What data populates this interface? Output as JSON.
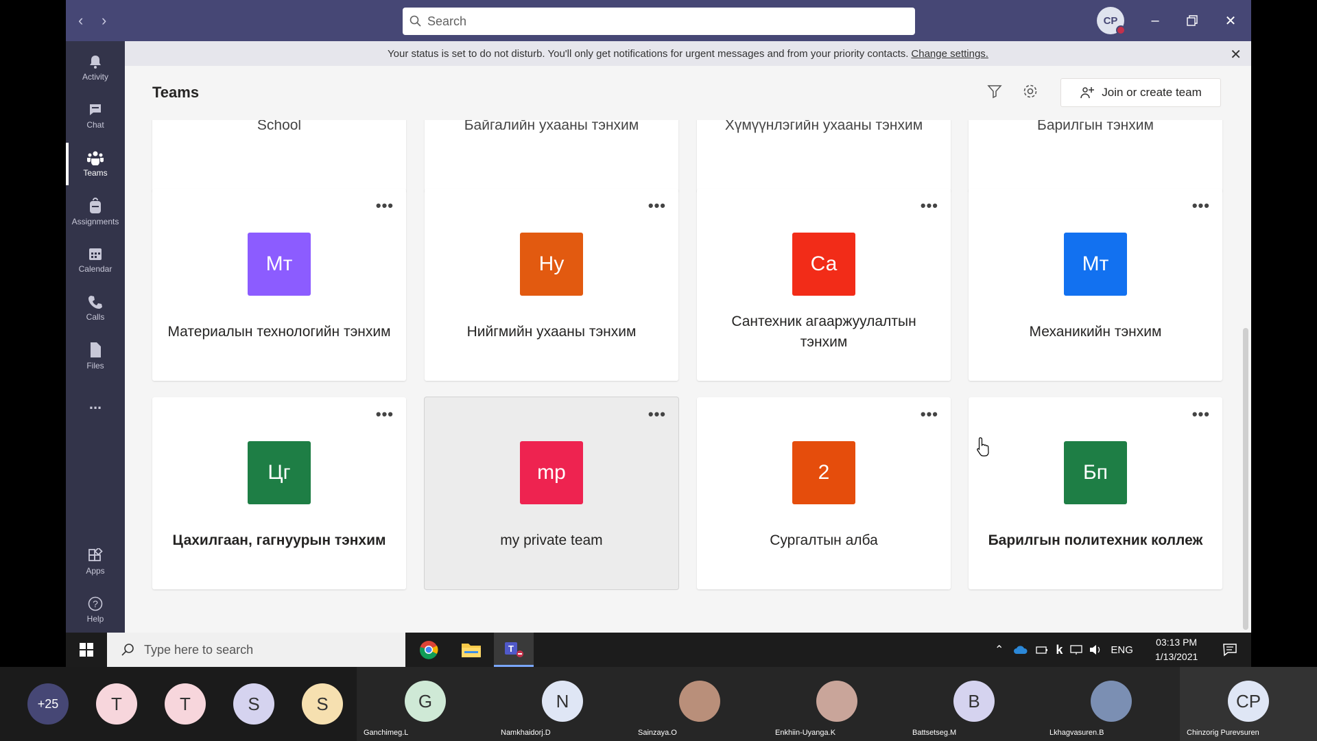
{
  "titlebar": {
    "search_placeholder": "Search",
    "user_initials": "CP"
  },
  "rail": [
    {
      "label": "Activity",
      "icon": "bell-icon"
    },
    {
      "label": "Chat",
      "icon": "chat-icon"
    },
    {
      "label": "Teams",
      "icon": "teams-icon",
      "active": true
    },
    {
      "label": "Assignments",
      "icon": "backpack-icon"
    },
    {
      "label": "Calendar",
      "icon": "calendar-icon"
    },
    {
      "label": "Calls",
      "icon": "phone-icon"
    },
    {
      "label": "Files",
      "icon": "file-icon"
    },
    {
      "label": "...",
      "icon": "more-icon"
    },
    {
      "label": "Apps",
      "icon": "apps-icon"
    },
    {
      "label": "Help",
      "icon": "help-icon"
    }
  ],
  "banner": {
    "text": "Your status is set to do not disturb. You'll only get notifications for urgent messages and from your priority contacts.",
    "link": "Change settings."
  },
  "header": {
    "title": "Teams",
    "join_label": "Join or create team"
  },
  "top_row": [
    "School",
    "Байгалийн ухааны тэнхим",
    "Хүмүүнлэгийн ухааны тэнхим",
    "Барилгын тэнхим"
  ],
  "teams": [
    {
      "initials": "Мт",
      "name": "Материалын технологийн тэнхим",
      "color": "#8c5cff",
      "bold": false
    },
    {
      "initials": "Ну",
      "name": "Нийгмийн ухааны тэнхим",
      "color": "#e25a10",
      "bold": false
    },
    {
      "initials": "Са",
      "name": "Сантехник агааржуулалтын тэнхим",
      "color": "#f22c18",
      "bold": false
    },
    {
      "initials": "Мт",
      "name": "Механикийн тэнхим",
      "color": "#1271f0",
      "bold": false
    },
    {
      "initials": "Цг",
      "name": "Цахилгаан, гагнуурын тэнхим",
      "color": "#1e7e45",
      "bold": true
    },
    {
      "initials": "mp",
      "name": "my private team",
      "color": "#ee2350",
      "bold": false
    },
    {
      "initials": "2",
      "name": "Сургалтын алба",
      "color": "#e54d0c",
      "bold": false
    },
    {
      "initials": "Бп",
      "name": "Барилгын политехник коллеж",
      "color": "#1e7e45",
      "bold": true
    }
  ],
  "more_label": "•••",
  "taskbar": {
    "search_placeholder": "Type here to search",
    "lang": "ENG",
    "time": "03:13 PM",
    "date": "1/13/2021"
  },
  "participants": {
    "overflow": "+25",
    "small": [
      {
        "initial": "T",
        "color": "#f7d6dc"
      },
      {
        "initial": "T",
        "color": "#f7d6dc"
      },
      {
        "initial": "S",
        "color": "#d5d3ef"
      },
      {
        "initial": "S",
        "color": "#f6e0b0"
      }
    ],
    "named": [
      {
        "initial": "G",
        "name": "Ganchimeg.L",
        "color": "#cfe9d6"
      },
      {
        "initial": "N",
        "name": "Namkhaidorj.D",
        "color": "#dfe6f5"
      },
      {
        "initial": "",
        "name": "Sainzaya.O",
        "color": "#b98f7a"
      },
      {
        "initial": "",
        "name": "Enkhiin-Uyanga.K",
        "color": "#c9a59a"
      },
      {
        "initial": "B",
        "name": "Battsetseg.M",
        "color": "#d5d3ef"
      },
      {
        "initial": "",
        "name": "Lkhagvasuren.B",
        "color": "#7b8fb3"
      },
      {
        "initial": "CP",
        "name": "Chinzorig Purevsuren",
        "color": "#dfe6f5"
      }
    ]
  }
}
